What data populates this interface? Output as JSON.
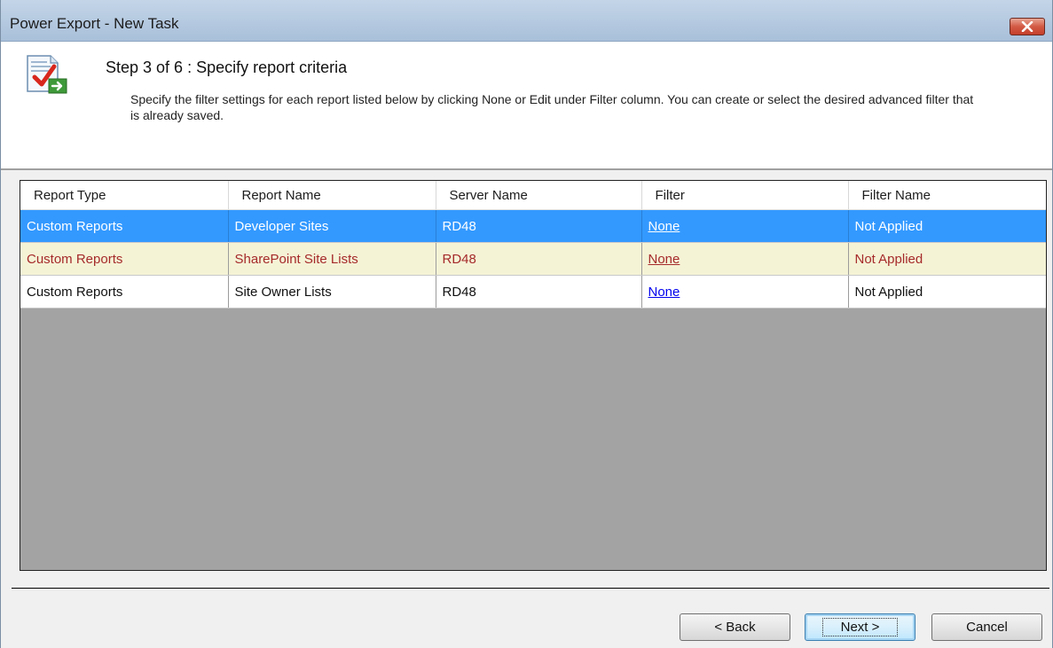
{
  "window": {
    "title": "Power Export - New Task"
  },
  "header": {
    "step_title": "Step 3 of 6 : Specify report criteria",
    "description": "Specify the filter settings for each report listed below by clicking None or Edit under Filter column. You can create or select the desired advanced filter that is already saved.",
    "icon": "report-check-icon"
  },
  "grid": {
    "columns": [
      "Report Type",
      "Report Name",
      "Server Name",
      "Filter",
      "Filter Name"
    ],
    "rows": [
      {
        "report_type": "Custom Reports",
        "report_name": "Developer Sites",
        "server_name": "RD48",
        "filter": "None",
        "filter_name": "Not Applied",
        "state": "selected"
      },
      {
        "report_type": "Custom Reports",
        "report_name": "SharePoint Site Lists",
        "server_name": "RD48",
        "filter": "None",
        "filter_name": "Not Applied",
        "state": "alternate"
      },
      {
        "report_type": "Custom Reports",
        "report_name": "Site Owner Lists",
        "server_name": "RD48",
        "filter": "None",
        "filter_name": "Not Applied",
        "state": "normal"
      }
    ]
  },
  "buttons": {
    "back_label": "< Back",
    "next_label": "Next >",
    "cancel_label": "Cancel"
  },
  "colors": {
    "selection": "#3399ff",
    "alternate_row": "#f5f3d6",
    "alternate_text": "#a52a2a",
    "grid_background": "#a3a3a3"
  }
}
